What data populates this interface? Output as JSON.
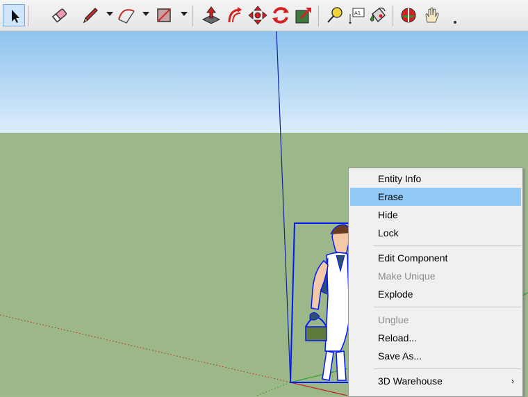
{
  "toolbar": {
    "tools": [
      {
        "name": "Select",
        "icon": "cursor-arrow-icon"
      },
      {
        "name": "Eraser",
        "icon": "eraser-icon"
      },
      {
        "name": "Line",
        "icon": "pencil-icon"
      },
      {
        "name": "Arc",
        "icon": "arc-icon"
      },
      {
        "name": "Rectangle",
        "icon": "rectangle-icon"
      },
      {
        "name": "Push/Pull",
        "icon": "push-pull-icon"
      },
      {
        "name": "Offset",
        "icon": "offset-icon"
      },
      {
        "name": "Move",
        "icon": "move-icon"
      },
      {
        "name": "Rotate",
        "icon": "rotate-icon"
      },
      {
        "name": "Scale",
        "icon": "scale-icon"
      },
      {
        "name": "Tape Measure",
        "icon": "tape-measure-icon"
      },
      {
        "name": "Text",
        "icon": "text-label-icon"
      },
      {
        "name": "Paint Bucket",
        "icon": "paint-bucket-icon"
      },
      {
        "name": "Orbit",
        "icon": "orbit-icon"
      },
      {
        "name": "Pan",
        "icon": "pan-hand-icon"
      }
    ],
    "text_tool_label": "A1",
    "colors": {
      "active_border": "#6fa8dc",
      "active_bg": "#cfe5fb",
      "accent_red": "#d42020",
      "accent_blue": "#2a5bbd"
    }
  },
  "viewport": {
    "sky_color": "#a8d0f2",
    "ground_color": "#9cb889",
    "selection_color": "#0018ff",
    "blue_axis_color": "#1020a0",
    "red_axis_color": "#c02020",
    "green_axis_color": "#20a020"
  },
  "context_menu": {
    "items": [
      {
        "label": "Entity Info",
        "enabled": true,
        "highlighted": false
      },
      {
        "label": "Erase",
        "enabled": true,
        "highlighted": true
      },
      {
        "label": "Hide",
        "enabled": true,
        "highlighted": false
      },
      {
        "label": "Lock",
        "enabled": true,
        "highlighted": false
      },
      {
        "label": "Edit Component",
        "enabled": true,
        "highlighted": false
      },
      {
        "label": "Make Unique",
        "enabled": false,
        "highlighted": false
      },
      {
        "label": "Explode",
        "enabled": true,
        "highlighted": false
      },
      {
        "label": "Unglue",
        "enabled": false,
        "highlighted": false
      },
      {
        "label": "Reload...",
        "enabled": true,
        "highlighted": false
      },
      {
        "label": "Save As...",
        "enabled": true,
        "highlighted": false
      },
      {
        "label": "3D Warehouse",
        "enabled": true,
        "highlighted": false,
        "submenu": true
      }
    ],
    "submenu_arrow": "›"
  }
}
